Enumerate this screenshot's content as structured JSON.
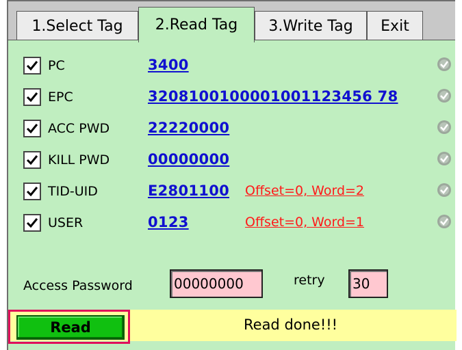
{
  "tabs": [
    {
      "label": "1.Select Tag"
    },
    {
      "label": "2.Read Tag"
    },
    {
      "label": "3.Write Tag"
    },
    {
      "label": "Exit"
    }
  ],
  "active_tab": "2.Read Tag",
  "fields": [
    {
      "label": "PC",
      "checked": true,
      "value": "3400",
      "extra": "",
      "status_icon": "check-circle-icon"
    },
    {
      "label": "EPC",
      "checked": true,
      "value": "3208100100001001123456 78",
      "extra": "",
      "status_icon": "check-circle-icon"
    },
    {
      "label": "ACC PWD",
      "checked": true,
      "value": "22220000",
      "extra": "",
      "status_icon": "check-circle-icon"
    },
    {
      "label": "KILL PWD",
      "checked": true,
      "value": "00000000",
      "extra": "",
      "status_icon": "check-circle-icon"
    },
    {
      "label": "TID-UID",
      "checked": true,
      "value": "E2801100",
      "extra": "Offset=0, Word=2",
      "status_icon": "check-circle-icon"
    },
    {
      "label": "USER",
      "checked": true,
      "value": "0123",
      "extra": "Offset=0, Word=1",
      "status_icon": "check-circle-icon"
    }
  ],
  "access_password": {
    "label": "Access Password",
    "value": "00000000"
  },
  "retry": {
    "label": "retry",
    "value": "30"
  },
  "read_button": {
    "label": "Read"
  },
  "status": {
    "text": "Read done!!!"
  },
  "colors": {
    "panel": "#c0eec0",
    "value_link": "#1010d0",
    "extra_link": "#ff1a1a",
    "status_bar": "#ffff9e",
    "input_bg": "#ffc8d0",
    "button": "#10c010",
    "highlight": "#e0105a"
  }
}
